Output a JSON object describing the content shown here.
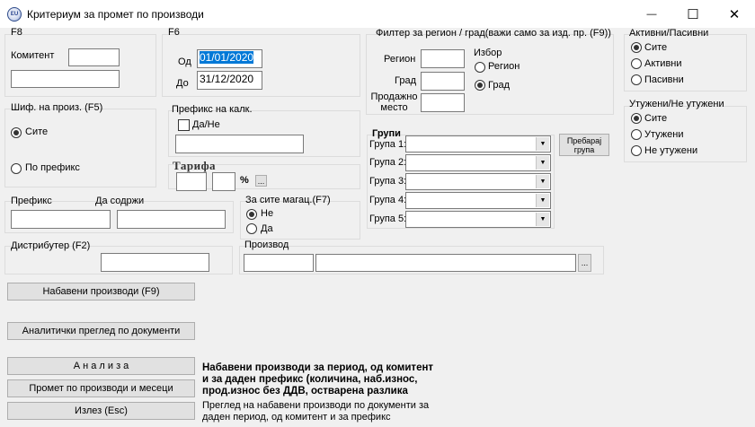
{
  "window": {
    "title": "Критериум за промет по производи",
    "icon_text": "EU",
    "minimize_glyph": "—",
    "maximize_glyph": "☐",
    "close_glyph": "✕"
  },
  "f8": {
    "legend": "F8",
    "komitent_label": "Комитент",
    "komitent_code": "",
    "komitent_name": ""
  },
  "f6": {
    "legend": "F6",
    "from_label": "Од",
    "from_value": "01/01/2020",
    "to_label": "До",
    "to_value": "31/12/2020"
  },
  "region_filter": {
    "legend": "Филтер за регион / град(важи само за изд. пр. (F9))",
    "region_label": "Регион",
    "city_label": "Град",
    "place_label_line1": "Продажно",
    "place_label_line2": "место",
    "choice_legend": "Избор",
    "opt_region": "Регион",
    "opt_city": "Град",
    "selected": "city"
  },
  "active_passive": {
    "legend": "Активни/Пасивни",
    "options": [
      "Сите",
      "Активни",
      "Пасивни"
    ],
    "selected": 0
  },
  "drowned": {
    "legend": "Утужени/Не утужени",
    "options": [
      "Сите",
      "Утужени",
      "Не утужени"
    ],
    "selected": 0
  },
  "product_code": {
    "legend": "Шиф. на произ. (F5)",
    "opt_all": "Сите",
    "opt_prefix": "По префикс",
    "selected": "all"
  },
  "calc_prefix": {
    "legend": "Префикс на калк.",
    "checkbox_label": "Да/Не",
    "checked": false,
    "value": ""
  },
  "tariff": {
    "legend": "Тарифа",
    "percent": "%",
    "ellipsis": "..."
  },
  "groups": {
    "legend": "Групи",
    "labels": [
      "Група 1:",
      "Група 2:",
      "Група 3:",
      "Група 4:",
      "Група 5:"
    ],
    "values": [
      "",
      "",
      "",
      "",
      ""
    ],
    "arrow": "▼",
    "search_button_line1": "Пребарај",
    "search_button_line2": "група"
  },
  "prefix": {
    "prefix_label": "Префикс",
    "contains_label": "Да содржи",
    "prefix_value": "",
    "contains_value": ""
  },
  "warehouses": {
    "legend": "За сите магац.(F7)",
    "opt_no": "Не",
    "opt_yes": "Да",
    "selected": "no"
  },
  "distributor": {
    "legend": "Дистрибутер (F2)",
    "value": ""
  },
  "product": {
    "legend": "Производ",
    "code": "",
    "name": "",
    "ellipsis": "..."
  },
  "buttons": {
    "purchased": "Набавени производи (F9)",
    "analytic": "Аналитички преглед по документи",
    "analysis": "А н а л и з а",
    "turnover": "Промет по производи и месеци",
    "exit": "Излез (Esc)"
  },
  "descriptions": {
    "analysis_line1": "Набавени производи за период, од комитент",
    "analysis_line2": "и за даден префикс (количина, наб.износ,",
    "analysis_line3": "прод.износ без ДДВ, остварена разлика",
    "exit_line1": "Преглед на набавени производи по документи за",
    "exit_line2": "даден период, од комитент и за префикс"
  }
}
